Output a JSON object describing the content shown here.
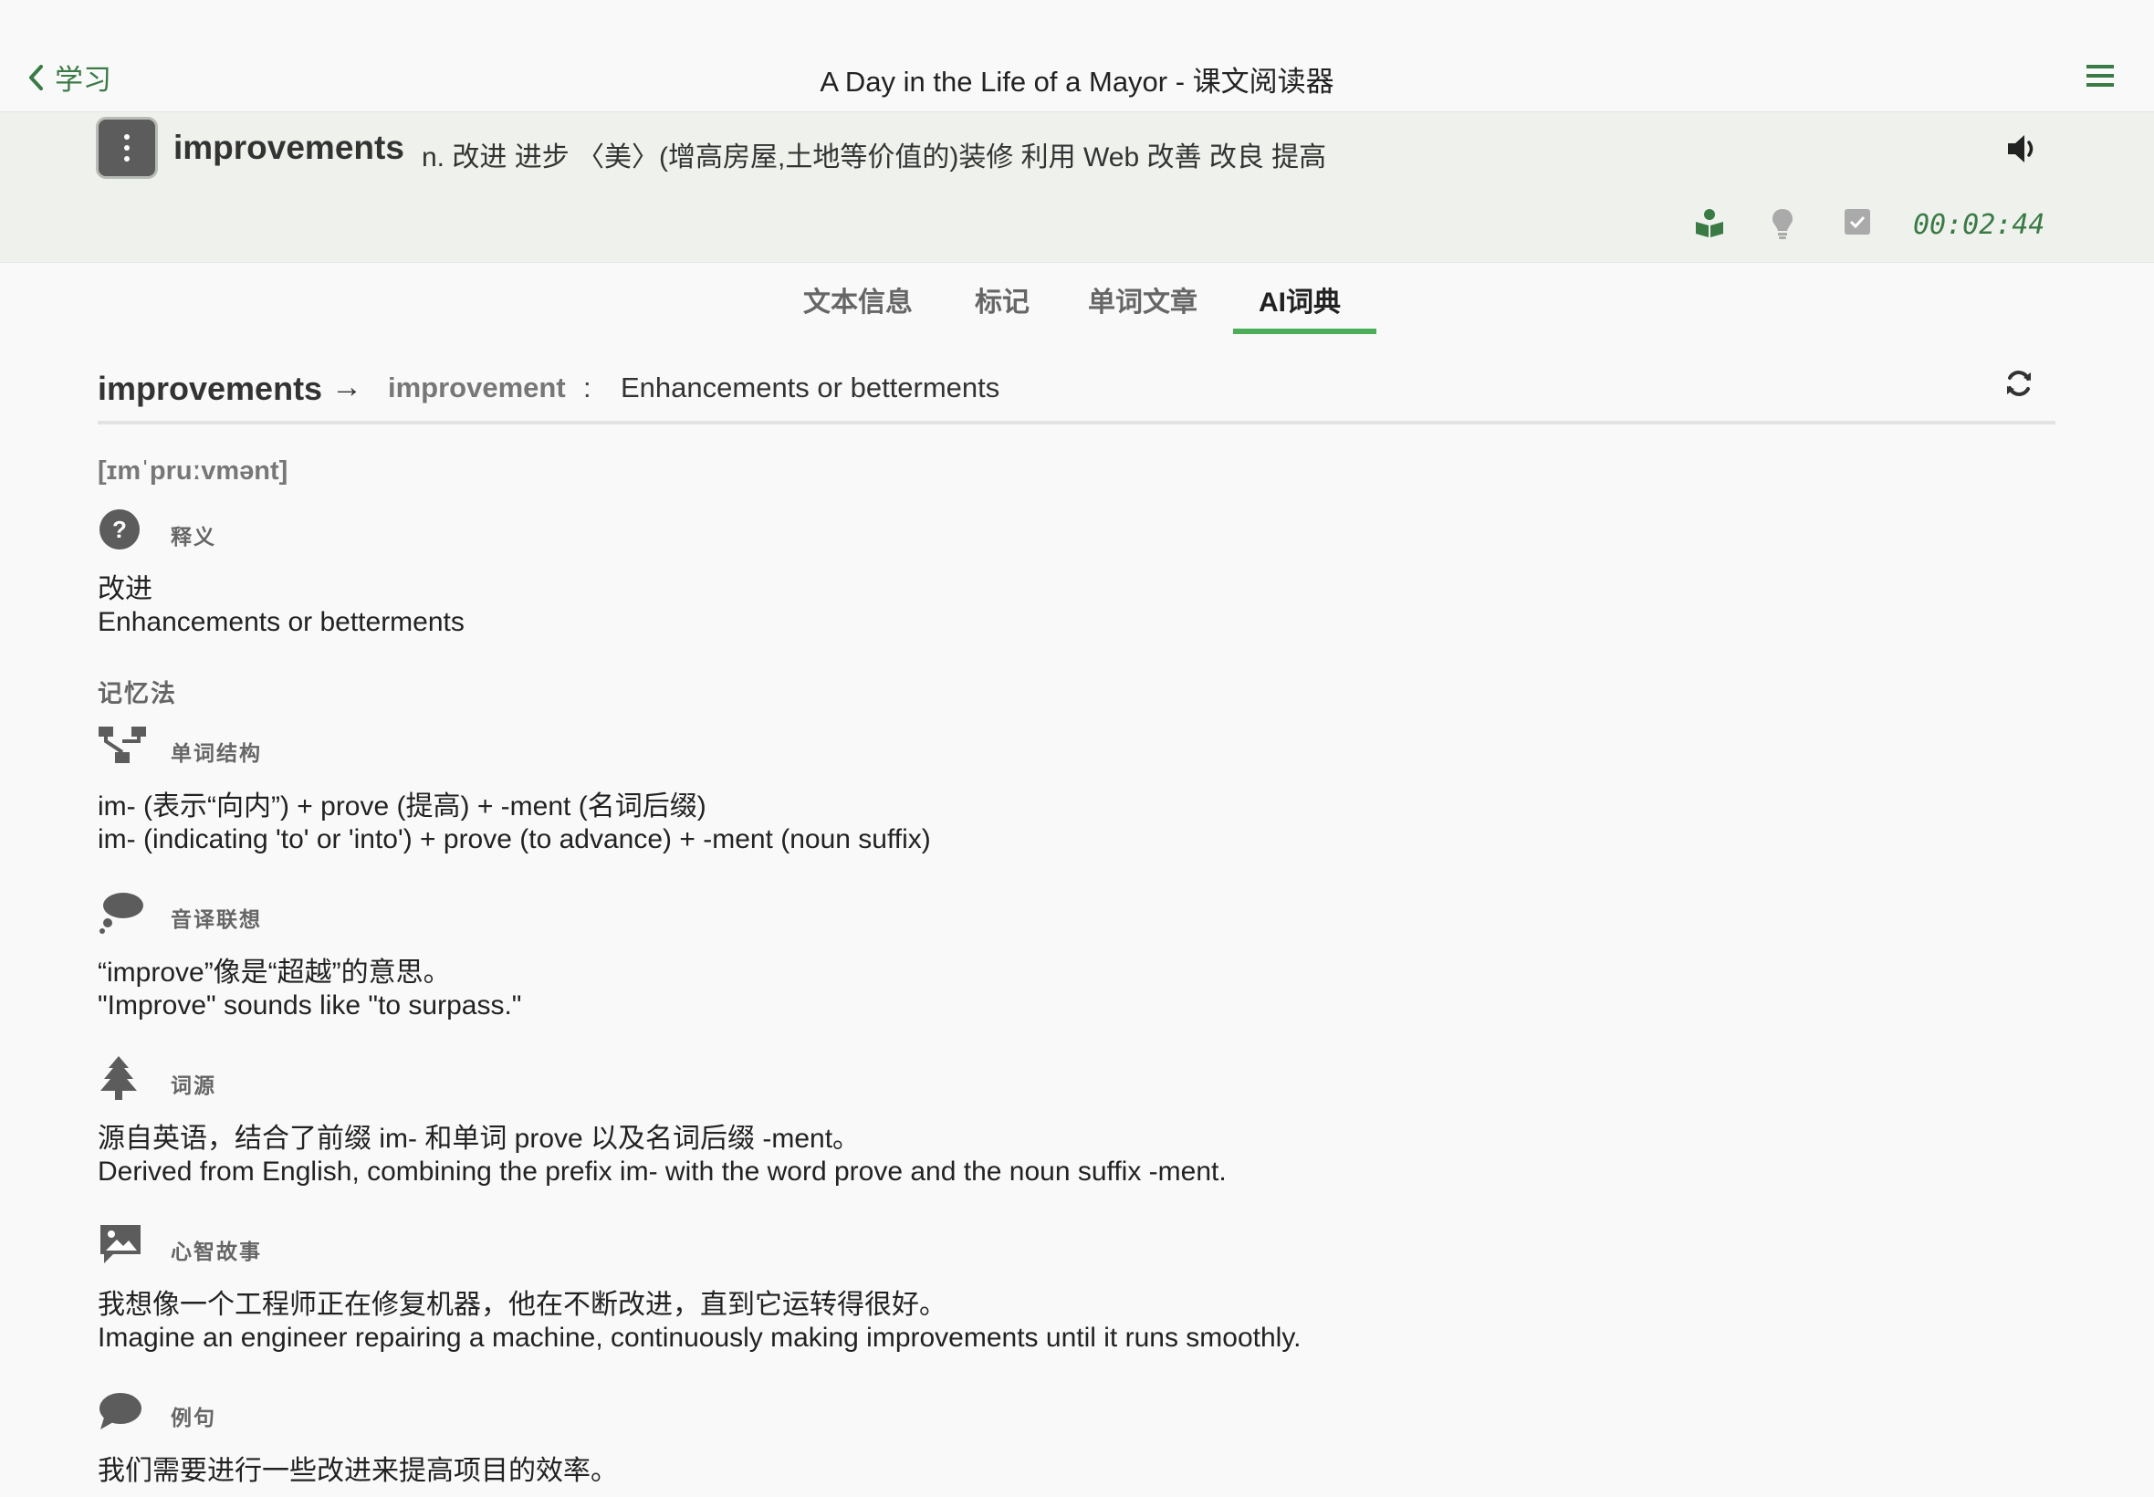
{
  "nav": {
    "back_label": "学习",
    "title": "A Day in the Life of a Mayor - 课文阅读器"
  },
  "word_bar": {
    "headword": "improvements",
    "definitions": "n. 改进 进步 〈美〉(增高房屋,土地等价值的)装修 利用 Web 改善 改良 提高"
  },
  "tools": {
    "timer": "00:02:44"
  },
  "tabs": [
    {
      "label": "文本信息",
      "active": false
    },
    {
      "label": "标记",
      "active": false
    },
    {
      "label": "单词文章",
      "active": false
    },
    {
      "label": "AI词典",
      "active": true
    }
  ],
  "entry": {
    "word": "improvements",
    "arrow": "→",
    "lemma": "improvement",
    "colon": ":",
    "gloss": "Enhancements or betterments",
    "phonetic": "[ɪmˈpruːvmənt]"
  },
  "definition": {
    "label": "释义",
    "zh": "改进",
    "en": "Enhancements or betterments"
  },
  "mnemonics_title": "记忆法",
  "sections": {
    "structure": {
      "label": "单词结构",
      "zh": "im- (表示“向内”) + prove (提高) + -ment (名词后缀)",
      "en": "im- (indicating 'to' or 'into') + prove (to advance) + -ment (noun suffix)"
    },
    "sound": {
      "label": "音译联想",
      "zh": "“improve”像是“超越”的意思。",
      "en": "\"Improve\" sounds like \"to surpass.\""
    },
    "etymology": {
      "label": "词源",
      "zh": "源自英语，结合了前缀 im- 和单词 prove 以及名词后缀 -ment。",
      "en": "Derived from English, combining the prefix im- with the word prove and the noun suffix -ment."
    },
    "story": {
      "label": "心智故事",
      "zh": "我想像一个工程师正在修复机器，他在不断改进，直到它运转得很好。",
      "en": "Imagine an engineer repairing a machine, continuously making improvements until it runs smoothly."
    },
    "example": {
      "label": "例句",
      "zh": "我们需要进行一些改进来提高项目的效率。"
    }
  },
  "colors": {
    "accent": "#3a7a45",
    "tab_underline": "#4cae59",
    "icon_gray": "#5c5c5c"
  },
  "icons": [
    "chevron-left-icon",
    "hamburger-menu-icon",
    "kebab-menu-icon",
    "speaker-icon",
    "book-reader-icon",
    "lightbulb-icon",
    "checkbox-icon",
    "refresh-icon",
    "question-circle-icon",
    "sitemap-icon",
    "thought-cloud-icon",
    "tree-icon",
    "image-comment-icon",
    "speech-bubble-icon"
  ]
}
